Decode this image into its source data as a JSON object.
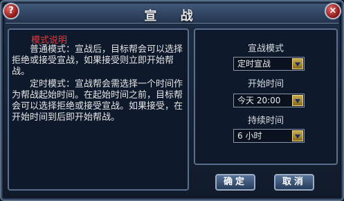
{
  "window": {
    "title": "宣 战"
  },
  "icons": {
    "help": "?",
    "close": "×"
  },
  "description": {
    "heading": "模式说明",
    "normal_mode": "　　普通模式：宣战后，目标帮会可以选择拒绝或接受宣战，如果接受则立即开始帮战。",
    "timed_mode": "　　定时模式：宣战帮会需选择一个时间作为帮战起始时间。在起始时间之前，目标帮会可以选择拒绝或接受宣战。如果接受，在开始时间到后即开始帮战。"
  },
  "form": {
    "mode_label": "宣战模式",
    "mode_value": "定时宣战",
    "start_label": "开始时间",
    "start_value": "今天 20:00",
    "duration_label": "持续时间",
    "duration_value": "6 小时"
  },
  "buttons": {
    "confirm": "确定",
    "cancel": "取消"
  }
}
